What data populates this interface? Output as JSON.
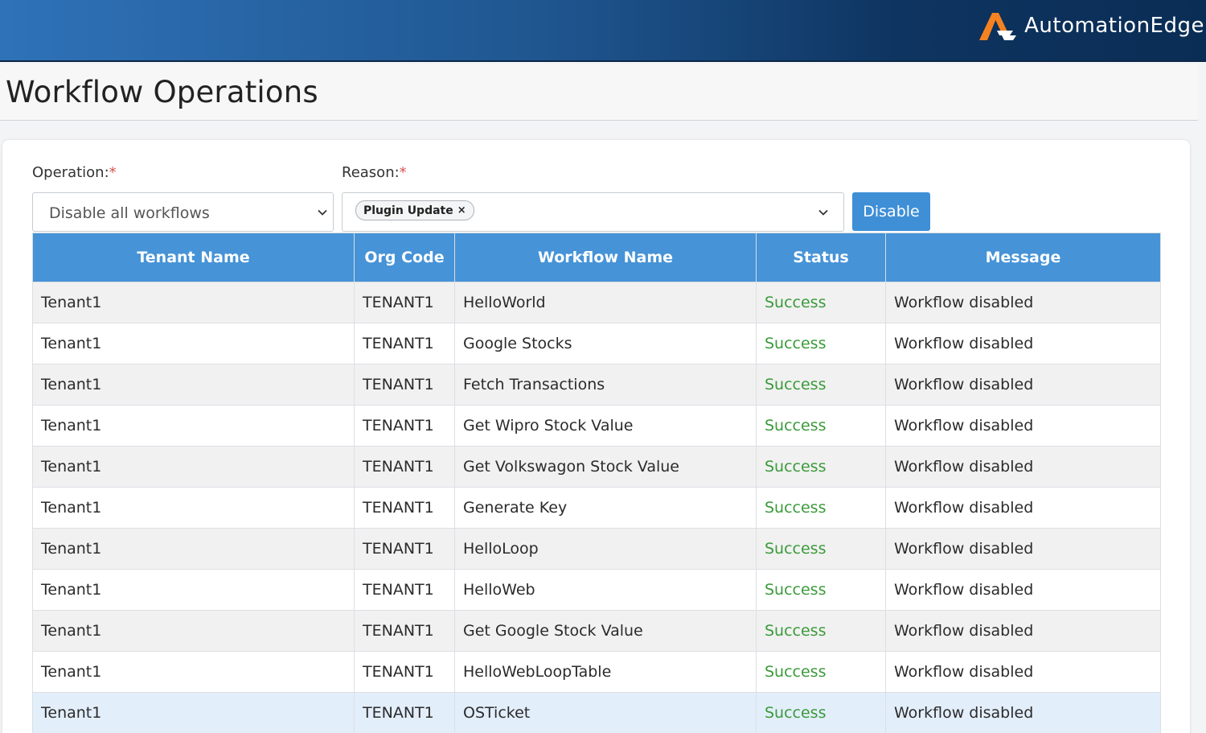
{
  "header": {
    "brand": "AutomationEdge",
    "brand_color": "#f58220",
    "accent": "#2f72b8"
  },
  "page": {
    "title": "Workflow Operations"
  },
  "form": {
    "operation_label": "Operation:",
    "reason_label": "Reason:",
    "required_mark": "*",
    "operation_value": "Disable all workflows",
    "reason_chip": "Plugin Update",
    "chip_remove": "×",
    "submit_label": "Disable"
  },
  "table": {
    "columns": [
      "Tenant Name",
      "Org Code",
      "Workflow Name",
      "Status",
      "Message"
    ],
    "status_color": "#3a9a3a",
    "rows": [
      [
        "Tenant1",
        "TENANT1",
        "HelloWorld",
        "Success",
        "Workflow disabled"
      ],
      [
        "Tenant1",
        "TENANT1",
        "Google Stocks",
        "Success",
        "Workflow disabled"
      ],
      [
        "Tenant1",
        "TENANT1",
        "Fetch Transactions",
        "Success",
        "Workflow disabled"
      ],
      [
        "Tenant1",
        "TENANT1",
        "Get Wipro Stock Value",
        "Success",
        "Workflow disabled"
      ],
      [
        "Tenant1",
        "TENANT1",
        "Get Volkswagon Stock Value",
        "Success",
        "Workflow disabled"
      ],
      [
        "Tenant1",
        "TENANT1",
        "Generate Key",
        "Success",
        "Workflow disabled"
      ],
      [
        "Tenant1",
        "TENANT1",
        "HelloLoop",
        "Success",
        "Workflow disabled"
      ],
      [
        "Tenant1",
        "TENANT1",
        "HelloWeb",
        "Success",
        "Workflow disabled"
      ],
      [
        "Tenant1",
        "TENANT1",
        "Get Google Stock Value",
        "Success",
        "Workflow disabled"
      ],
      [
        "Tenant1",
        "TENANT1",
        "HelloWebLoopTable",
        "Success",
        "Workflow disabled"
      ],
      [
        "Tenant1",
        "TENANT1",
        "OSTicket",
        "Success",
        "Workflow disabled"
      ]
    ]
  }
}
